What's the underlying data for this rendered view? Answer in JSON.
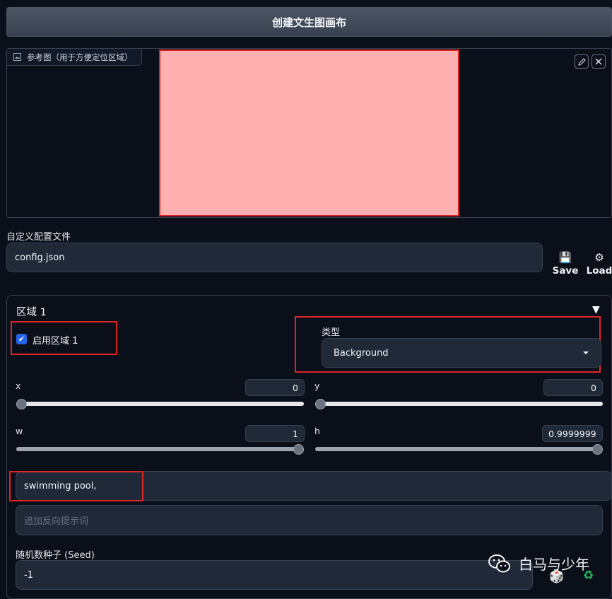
{
  "header": {
    "title": "创建文生图画布"
  },
  "reference_image": {
    "tab_label": "参考图（用于方便定位区域）",
    "canvas_color": "#ffb0b0"
  },
  "config": {
    "label": "自定义配置文件",
    "value": "config.json",
    "save_label": "Save",
    "load_label": "Load"
  },
  "region": {
    "title": "区域 1",
    "toggle_icon": "▼",
    "enable_label": "启用区域 1",
    "enabled": true,
    "type_label": "类型",
    "type_value": "Background",
    "sliders": {
      "x": {
        "label": "x",
        "value": "0",
        "fraction": 0
      },
      "y": {
        "label": "y",
        "value": "0",
        "fraction": 0
      },
      "w": {
        "label": "w",
        "value": "1",
        "fraction": 1
      },
      "h": {
        "label": "h",
        "value": "0.9999999",
        "fraction": 1
      }
    },
    "prompt": "swimming pool,",
    "negative_placeholder": "追加反向提示词",
    "seed_label": "随机数种子 (Seed)",
    "seed_value": "-1"
  },
  "watermark": {
    "text": "白马与少年"
  },
  "colors": {
    "accent_blue": "#2563eb",
    "highlight_red": "#dc2626",
    "recycle_green": "#22c55e"
  }
}
